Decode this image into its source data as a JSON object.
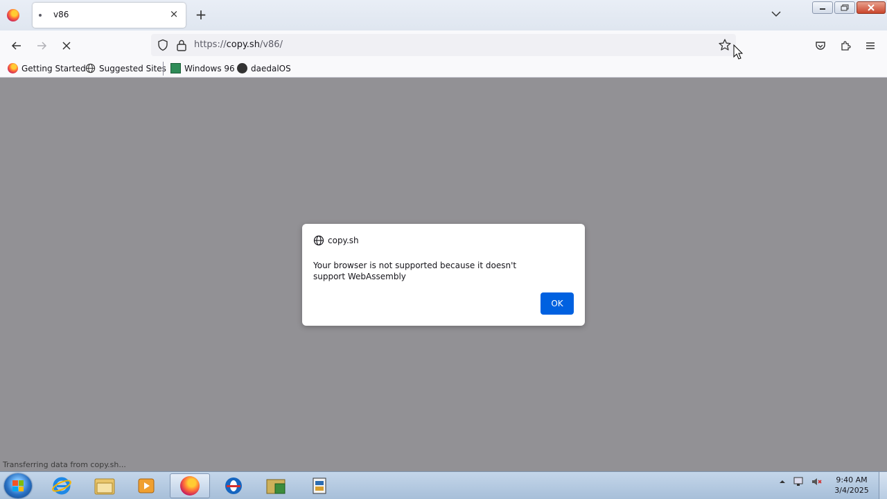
{
  "browser": {
    "tab": {
      "title": "v86",
      "close_glyph": "×"
    },
    "new_tab_glyph": "+",
    "url": {
      "scheme": "https://",
      "host": "copy.sh",
      "path": "/v86/"
    },
    "bookmarks": [
      {
        "label": "Getting Started",
        "icon": "firefox-icon"
      },
      {
        "label": "Suggested Sites",
        "icon": "globe-icon"
      },
      {
        "label": "Windows 96",
        "icon": "windows96-icon"
      },
      {
        "label": "daedalOS",
        "icon": "daedalos-icon"
      }
    ]
  },
  "dialog": {
    "origin": "copy.sh",
    "message": "Your browser is not supported because it doesn't support WebAssembly",
    "ok_label": "OK"
  },
  "status": {
    "text": "Transferring data from copy.sh..."
  },
  "taskbar": {
    "clock": {
      "time": "9:40 AM",
      "date": "3/4/2025"
    },
    "apps": [
      "internet-explorer",
      "file-explorer",
      "media-player",
      "firefox",
      "opera",
      "folder-app",
      "control-panel-app"
    ]
  },
  "colors": {
    "accent": "#0061e0",
    "content_bg": "#929195",
    "toolbar_bg": "#f9f9fb"
  }
}
